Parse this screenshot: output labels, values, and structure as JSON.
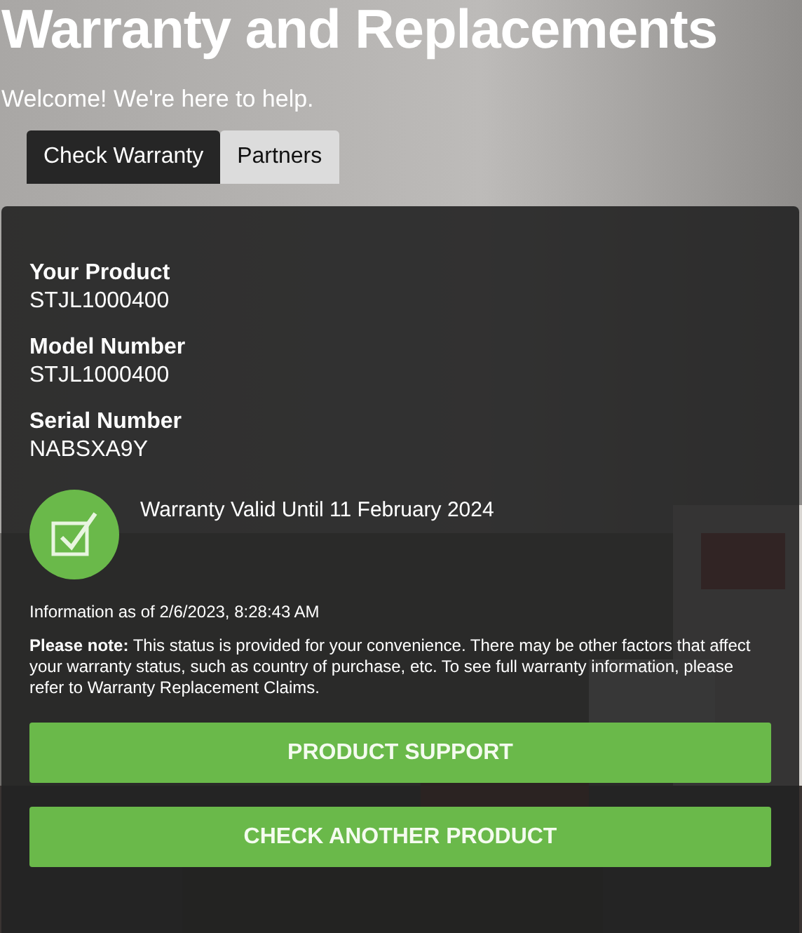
{
  "header": {
    "title": "Warranty and Replacements",
    "subtitle": "Welcome! We're here to help."
  },
  "tabs": [
    {
      "label": "Check Warranty",
      "selected": true
    },
    {
      "label": "Partners",
      "selected": false
    }
  ],
  "product": {
    "fields": [
      {
        "label": "Your Product",
        "value": "STJL1000400"
      },
      {
        "label": "Model Number",
        "value": "STJL1000400"
      },
      {
        "label": "Serial Number",
        "value": "NABSXA9Y"
      }
    ],
    "status": {
      "valid": true,
      "text": "Warranty Valid Until 11 February 2024"
    },
    "timestamp": "Information as of 2/6/2023, 8:28:43 AM",
    "note": "**Please note:** This status is provided for your convenience. There may be other factors that affect your warranty status, such as country of purchase, etc. To see full warranty information, please refer to Warranty Replacement Claims."
  },
  "buttons": [
    "PRODUCT SUPPORT",
    "CHECK ANOTHER PRODUCT"
  ]
}
